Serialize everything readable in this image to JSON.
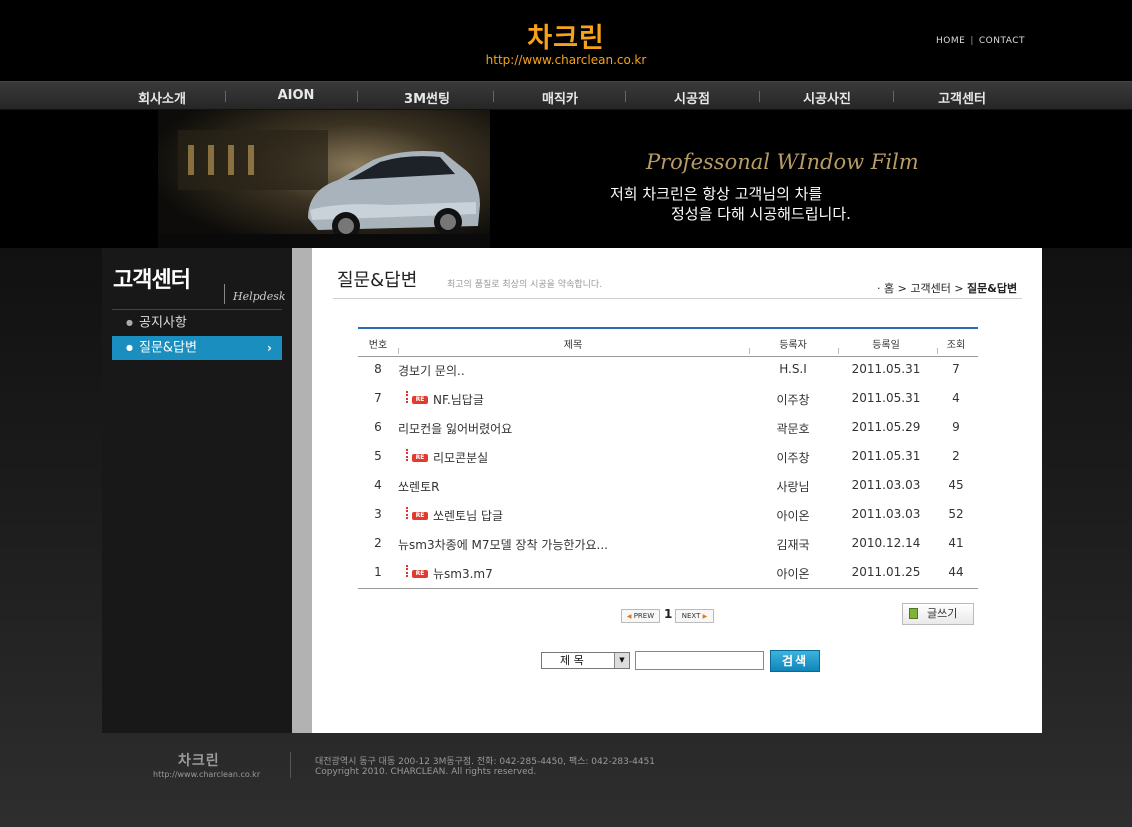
{
  "header": {
    "logo": "차크린",
    "url": "http://www.charclean.co.kr",
    "links": [
      "HOME",
      "CONTACT"
    ]
  },
  "nav": [
    "회사소개",
    "AION",
    "3M썬팅",
    "매직카",
    "시공점",
    "시공사진",
    "고객센터"
  ],
  "banner": {
    "tagline": "Professonal WIndow Film",
    "line1": "저희 차크린은 항상 고객님의 차를",
    "line2": "정성을 다해 시공해드립니다."
  },
  "sidebar": {
    "title": "고객센터",
    "subtitle": "Helpdesk",
    "items": [
      {
        "label": "공지사항",
        "active": false
      },
      {
        "label": "질문&답변",
        "active": true
      }
    ]
  },
  "page": {
    "title": "질문&답변",
    "description": "최고의 품질로 최상의 시공을 약속합니다.",
    "breadcrumb": [
      "홈",
      "고객센터",
      "질문&답변"
    ]
  },
  "table": {
    "columns": [
      "번호",
      "제목",
      "등록자",
      "등록일",
      "조회"
    ],
    "rows": [
      {
        "no": "8",
        "title": "경보기 문의..",
        "reply": false,
        "author": "H.S.I",
        "date": "2011.05.31",
        "views": "7"
      },
      {
        "no": "7",
        "title": "NF.님답글",
        "reply": true,
        "author": "이주창",
        "date": "2011.05.31",
        "views": "4"
      },
      {
        "no": "6",
        "title": "리모컨을 잃어버렸어요",
        "reply": false,
        "author": "곽문호",
        "date": "2011.05.29",
        "views": "9"
      },
      {
        "no": "5",
        "title": "리모콘분실",
        "reply": true,
        "author": "이주창",
        "date": "2011.05.31",
        "views": "2"
      },
      {
        "no": "4",
        "title": "쏘렌토R",
        "reply": false,
        "author": "사랑님",
        "date": "2011.03.03",
        "views": "45"
      },
      {
        "no": "3",
        "title": "쏘렌토님 답글",
        "reply": true,
        "author": "아이온",
        "date": "2011.03.03",
        "views": "52"
      },
      {
        "no": "2",
        "title": "뉴sm3차종에 M7모델 장착 가능한가요...",
        "reply": false,
        "author": "김재국",
        "date": "2010.12.14",
        "views": "41"
      },
      {
        "no": "1",
        "title": "뉴sm3.m7",
        "reply": true,
        "author": "아이온",
        "date": "2011.01.25",
        "views": "44"
      }
    ],
    "reply_badge": "RE"
  },
  "pager": {
    "prev": "PREW",
    "current": "1",
    "next": "NEXT"
  },
  "write_button": "글쓰기",
  "search": {
    "field": "제 목",
    "button": "검색",
    "value": ""
  },
  "footer": {
    "logo": "차크린",
    "url": "http://www.charclean.co.kr",
    "address": "대전광역시 동구 대동 200-12  3M동구점.  전화: 042-285-4450, 팩스: 042-283-4451",
    "copyright": "Copyright 2010.  CHARCLEAN.  All rights reserved."
  },
  "colors": {
    "brand": "#f6a21a",
    "accent": "#1a8fbf",
    "table_top": "#2b6cb4"
  }
}
